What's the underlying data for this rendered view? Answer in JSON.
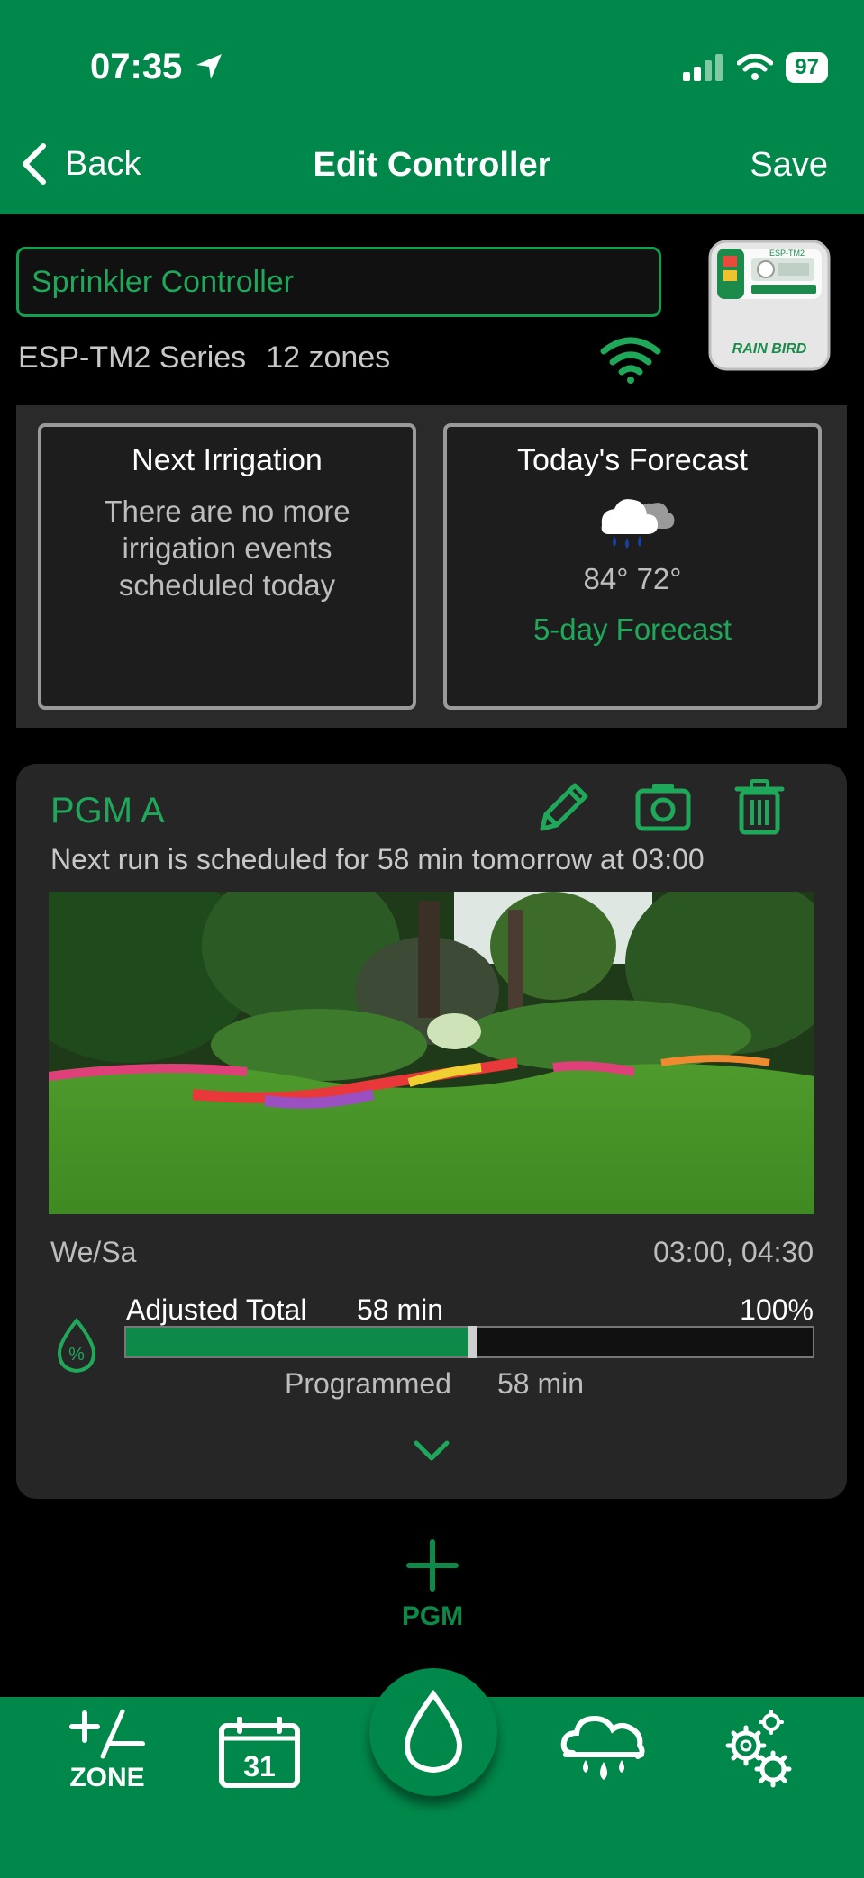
{
  "status_bar": {
    "time": "07:35",
    "battery": "97"
  },
  "nav": {
    "back_label": "Back",
    "title": "Edit Controller",
    "save_label": "Save"
  },
  "controller": {
    "name": "Sprinkler Controller",
    "model": "ESP-TM2 Series",
    "zones": "12 zones",
    "device_model_badge": "ESP-TM2",
    "device_brand": "RAIN BIRD"
  },
  "next_irrigation": {
    "title": "Next Irrigation",
    "message": "There are no more irrigation events scheduled today"
  },
  "forecast": {
    "title": "Today's Forecast",
    "icon": "rain-cloud-icon",
    "temps": "84° 72°",
    "link": "5-day Forecast"
  },
  "program": {
    "name": "PGM A",
    "next_run": "Next run is scheduled for 58 min tomorrow at 03:00",
    "days": "We/Sa",
    "start_times": "03:00, 04:30",
    "adjusted_label": "Adjusted Total",
    "adjusted_value": "58 min",
    "adjust_percent": "100%",
    "adjust_fraction": 0.5,
    "programmed_label": "Programmed",
    "programmed_value": "58 min"
  },
  "add_program": {
    "label": "PGM"
  },
  "tabs": [
    {
      "label": "ZONE",
      "icon": "plus-minus-icon"
    },
    {
      "label": "31",
      "icon": "calendar-icon"
    },
    {
      "label": "",
      "icon": "water-drop-icon"
    },
    {
      "label": "",
      "icon": "weather-icon"
    },
    {
      "label": "",
      "icon": "settings-gears-icon"
    }
  ],
  "colors": {
    "brand_green": "#00884a",
    "accent_green": "#1fa85a"
  }
}
